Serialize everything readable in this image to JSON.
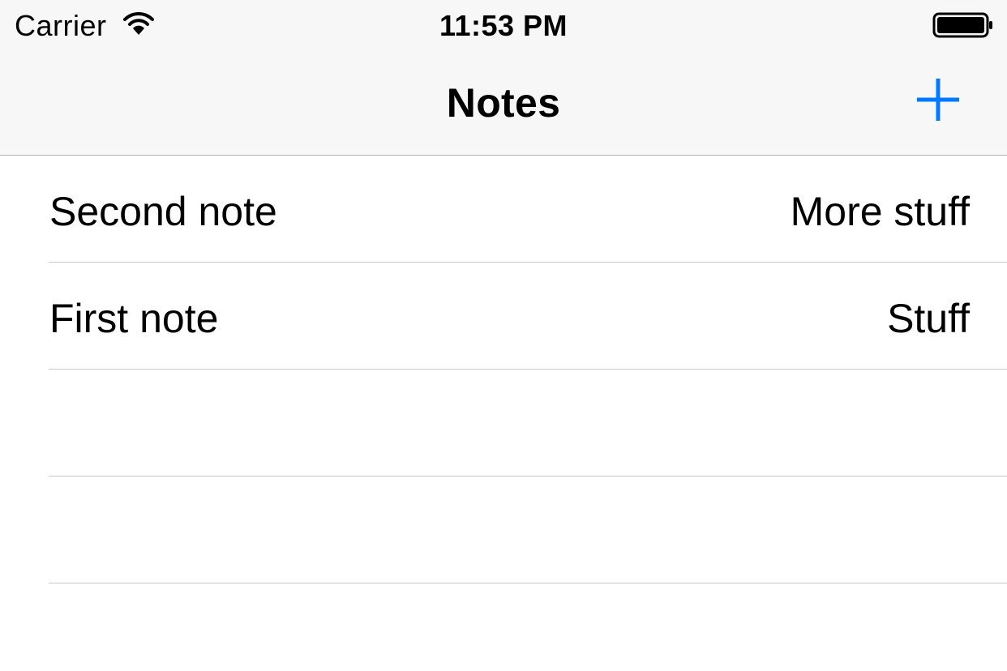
{
  "status_bar": {
    "carrier": "Carrier",
    "time": "11:53 PM",
    "wifi_icon": "wifi-icon",
    "battery_icon": "battery-icon"
  },
  "nav_bar": {
    "title": "Notes",
    "add_icon": "plus-icon"
  },
  "notes": [
    {
      "title": "Second note",
      "detail": "More stuff"
    },
    {
      "title": "First note",
      "detail": "Stuff"
    },
    {
      "title": "",
      "detail": ""
    },
    {
      "title": "",
      "detail": ""
    }
  ],
  "colors": {
    "accent": "#007aff",
    "bar_background": "#f7f7f7",
    "separator": "#c8c7cc",
    "bar_border": "#b2b2b2"
  }
}
